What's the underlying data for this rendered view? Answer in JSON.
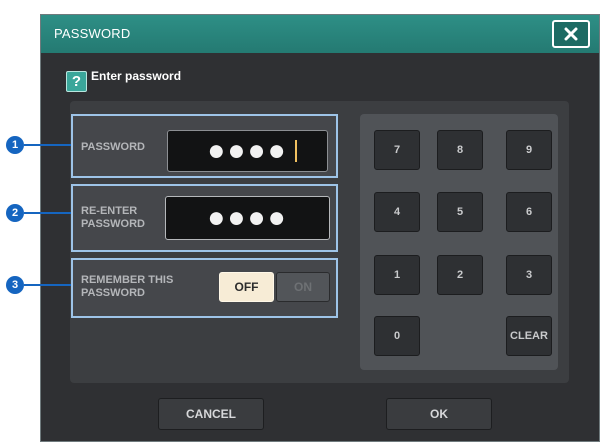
{
  "dialog": {
    "title": "PASSWORD",
    "close_icon": "close-icon",
    "help_icon_glyph": "?",
    "header_text": "Enter password"
  },
  "password_field": {
    "label": "PASSWORD",
    "masked_value": "●●●●"
  },
  "reenter_field": {
    "label": "RE-ENTER\nPASSWORD",
    "masked_value": "●●●●"
  },
  "remember": {
    "label": "REMEMBER THIS\nPASSWORD",
    "off_label": "OFF",
    "on_label": "ON",
    "state": "OFF"
  },
  "keypad": {
    "keys": [
      "7",
      "8",
      "9",
      "4",
      "5",
      "6",
      "1",
      "2",
      "3",
      "0",
      "CLEAR"
    ]
  },
  "buttons": {
    "cancel": "CANCEL",
    "ok": "OK"
  },
  "callouts": [
    "1",
    "2",
    "3"
  ],
  "colors": {
    "titlebar": "#2a857c",
    "dialog_bg": "#2f3033",
    "highlight_border": "#9ec4e8",
    "callout": "#1565c0",
    "toggle_active": "#f7ecd6"
  }
}
